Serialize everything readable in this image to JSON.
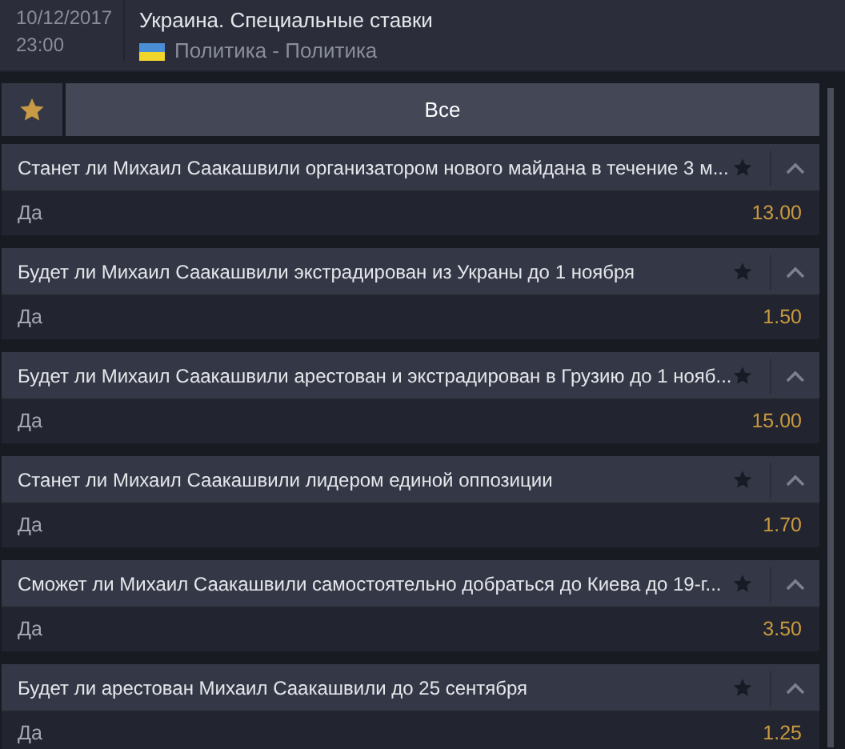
{
  "event": {
    "date": "10/12/2017",
    "time": "23:00",
    "title": "Украина. Специальные ставки",
    "category": "Политика - Политика"
  },
  "filter": {
    "label": "Все"
  },
  "markets": [
    {
      "title": "Станет ли Михаил Саакашвили организатором нового майдана в течение 3 м...",
      "favorite": false,
      "expanded": true,
      "outcome": "Да",
      "odds": "13.00"
    },
    {
      "title": "Будет ли Михаил Саакашвили экстрадирован из Украны до 1 ноября",
      "favorite": false,
      "expanded": true,
      "outcome": "Да",
      "odds": "1.50"
    },
    {
      "title": "Будет ли Михаил Саакашвили арестован и экстрадирован в Грузию до 1 нояб...",
      "favorite": false,
      "expanded": true,
      "outcome": "Да",
      "odds": "15.00"
    },
    {
      "title": "Станет ли Михаил Саакашвили лидером единой оппозиции",
      "favorite": false,
      "expanded": true,
      "outcome": "Да",
      "odds": "1.70"
    },
    {
      "title": "Сможет ли Михаил Саакашвили самостоятельно добраться до Киева до 19-г...",
      "favorite": false,
      "expanded": true,
      "outcome": "Да",
      "odds": "3.50"
    },
    {
      "title": "Будет ли арестован Михаил Саакашвили до 25 сентября",
      "favorite": false,
      "expanded": true,
      "outcome": "Да",
      "odds": "1.25"
    }
  ]
}
